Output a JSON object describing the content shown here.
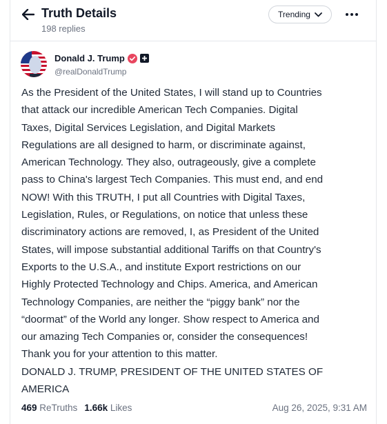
{
  "header": {
    "title": "Truth Details",
    "replies": "198 replies",
    "sort_label": "Trending"
  },
  "post": {
    "author_name": "Donald J. Trump",
    "handle": "@realDonaldTrump",
    "body": "As the President of the United States, I will stand up to Countries\nthat attack our incredible American Tech Companies. Digital\nTaxes, Digital Services Legislation, and Digital Markets\nRegulations are all designed to harm, or discriminate against,\nAmerican Technology. They also, outrageously, give a complete\npass to China's largest Tech Companies. This must end, and end\nNOW! With this TRUTH, I put all Countries with Digital Taxes,\nLegislation, Rules, or Regulations, on notice that unless these\ndiscriminatory actions are removed, I, as President of the United\nStates, will impose substantial additional Tariffs on that Country's\nExports to the U.S.A., and institute Export restrictions on our\nHighly Protected Technology and Chips. America, and American\nTechnology Companies, are neither the “piggy bank” nor the\n“doormat” of the World any longer. Show respect to America and\nour amazing Tech Companies or, consider the consequences!\nThank you for your attention to this matter.\nDONALD J. TRUMP, PRESIDENT OF THE UNITED STATES OF\nAMERICA",
    "retruths_count": "469",
    "retruths_label": "ReTruths",
    "likes_count": "1.66k",
    "likes_label": "Likes",
    "timestamp": "Aug 26, 2025, 9:31 AM"
  },
  "colors": {
    "verified_badge": "#e8465f",
    "text_primary": "#111827",
    "text_muted": "#6b7280"
  },
  "icons": {
    "back": "arrow-left-icon",
    "sort": "chevron-down-icon",
    "more": "more-dots-icon",
    "verified": "verified-badge-icon",
    "extra": "plus-badge-icon"
  }
}
